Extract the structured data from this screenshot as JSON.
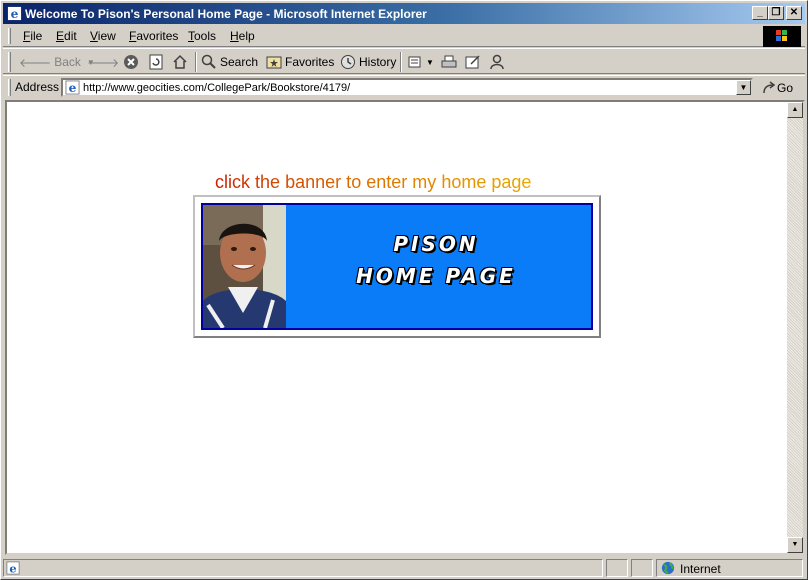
{
  "window": {
    "title": "Welcome To Pison's Personal Home Page - Microsoft Internet Explorer",
    "minimize": "_",
    "restore": "❐",
    "close": "✕"
  },
  "menu": {
    "items": [
      {
        "label": "File"
      },
      {
        "label": "Edit"
      },
      {
        "label": "View"
      },
      {
        "label": "Favorites"
      },
      {
        "label": "Tools"
      },
      {
        "label": "Help"
      }
    ]
  },
  "toolbar": {
    "back_label": "Back",
    "search_label": "Search",
    "favorites_label": "Favorites",
    "history_label": "History"
  },
  "address": {
    "label": "Address",
    "url": "http://www.geocities.com/CollegePark/Bookstore/4179/",
    "go_label": "Go"
  },
  "page": {
    "headline_part1": "click the banner",
    "headline_part2": " to enter my home page",
    "headline_colors": [
      "#cc2200",
      "#e8a800"
    ],
    "banner_line1": "PISON",
    "banner_line2": "HOME PAGE",
    "banner_color": "#0a7cf8"
  },
  "status": {
    "zone_label": "Internet"
  }
}
